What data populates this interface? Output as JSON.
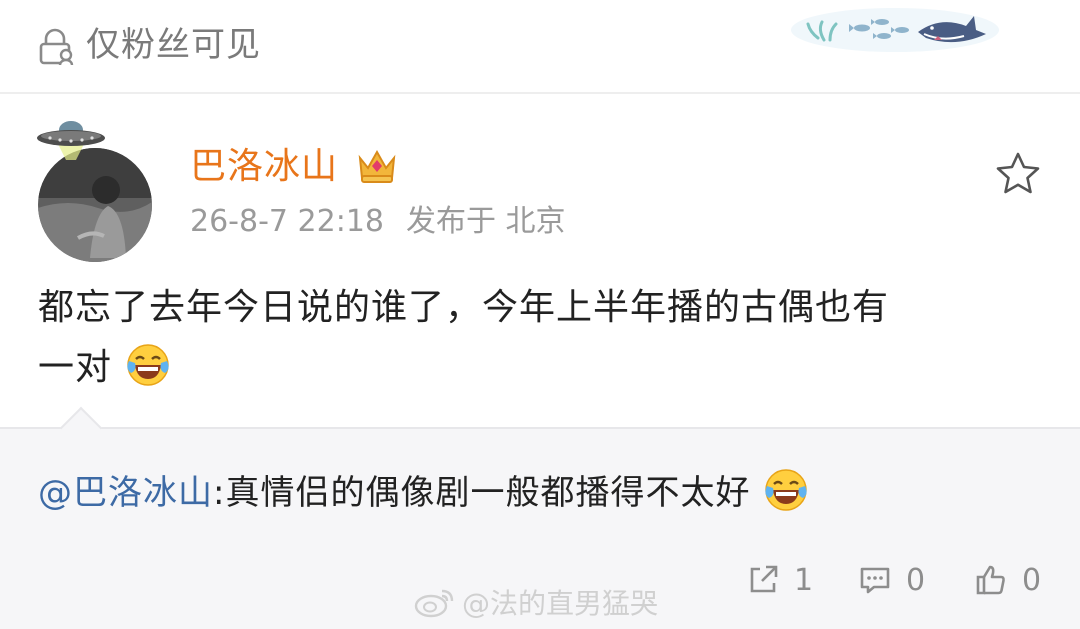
{
  "visibility": {
    "icon": "lock-person-icon",
    "label": "仅粉丝可见"
  },
  "post": {
    "username": "巴洛冰山",
    "badge_icon": "crown-icon",
    "timestamp": "26-8-7 22:18",
    "location": "发布于 北京",
    "favorite_icon": "star-outline-icon",
    "content_line1": "都忘了去年今日说的谁了，今年上半年播的古偶也有",
    "content_line2": "一对",
    "content_emoji": "laughing-tears-emoji"
  },
  "reply": {
    "mention": "@巴洛冰山",
    "text": ":真情侣的偶像剧一般都播得不太好",
    "emoji": "laughing-tears-emoji"
  },
  "actions": {
    "repost_count": "1",
    "comment_count": "0",
    "like_count": "0"
  },
  "watermark": {
    "icon": "weibo-logo-icon",
    "text": "@法的直男猛哭"
  },
  "colors": {
    "username": "#e8751a",
    "mention": "#3d6aa5",
    "muted": "#8d8d8d",
    "reply_bg": "#f6f6f8"
  }
}
